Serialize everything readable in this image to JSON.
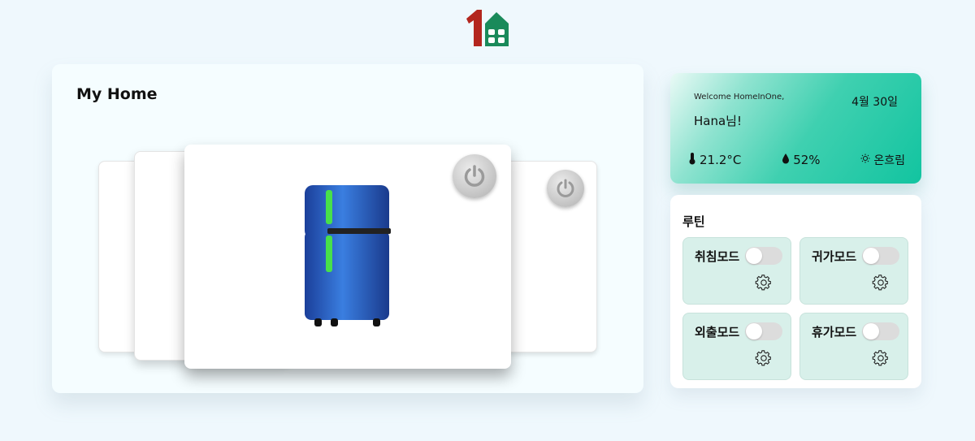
{
  "header": {
    "logo_icon": "homeinone-logo-icon"
  },
  "home": {
    "title": "My Home",
    "devices": [
      {
        "name": "refrigerator",
        "icon": "refrigerator-icon",
        "power_icon": "power-icon"
      }
    ]
  },
  "welcome": {
    "greeting": "Welcome HomeInOne,",
    "user": "Hana님!",
    "date": "4월 30일",
    "temperature": "21.2°C",
    "humidity": "52%",
    "weather": "온흐림",
    "temp_icon": "thermometer-icon",
    "humidity_icon": "droplet-icon",
    "weather_icon": "sun-icon"
  },
  "routine": {
    "title": "루틴",
    "modes": [
      {
        "label": "취침모드",
        "enabled": false
      },
      {
        "label": "귀가모드",
        "enabled": false
      },
      {
        "label": "외출모드",
        "enabled": false
      },
      {
        "label": "휴가모드",
        "enabled": false
      }
    ]
  },
  "colors": {
    "accent": "#12c4a0",
    "logo_red": "#b3261e",
    "logo_green": "#1a8a5a",
    "mode_bg": "#d8f0ea"
  }
}
